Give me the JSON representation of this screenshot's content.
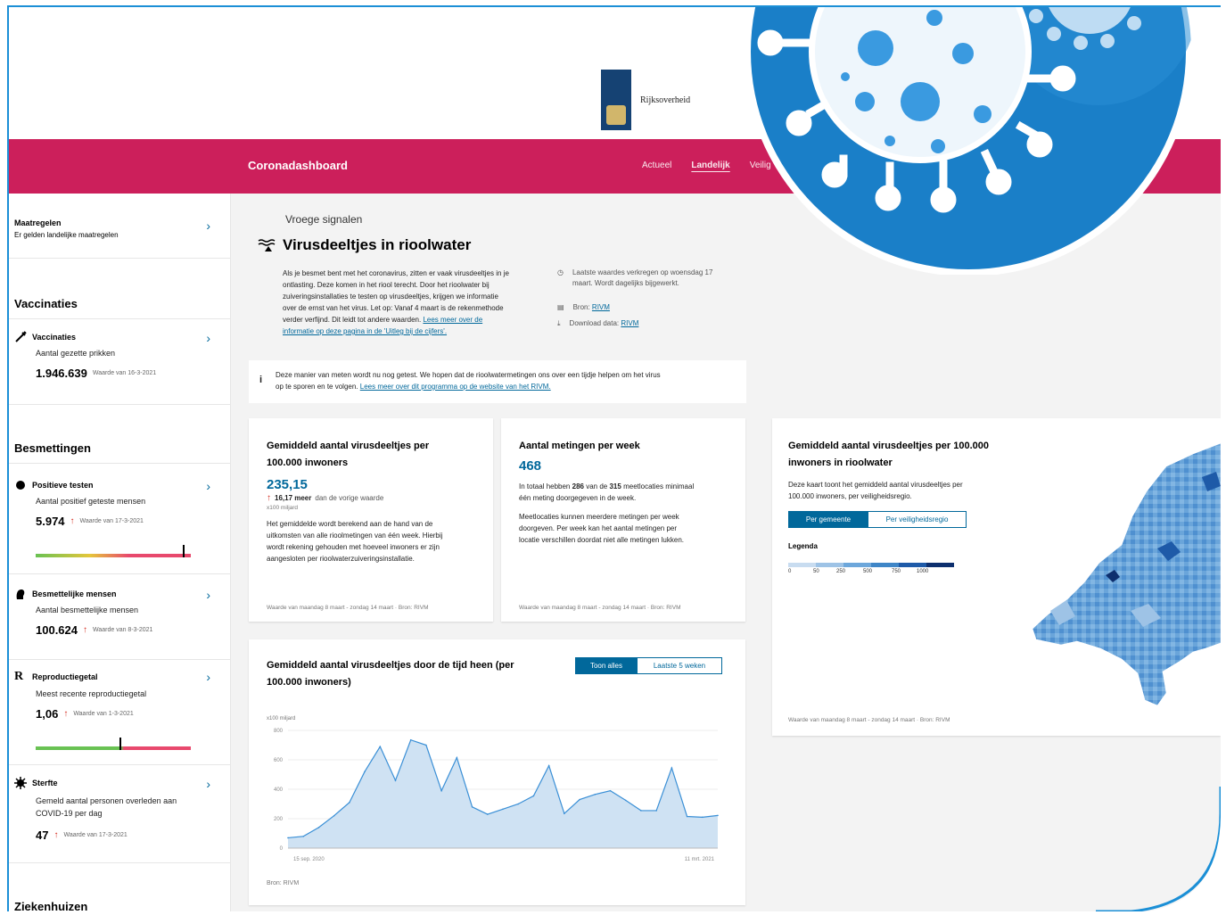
{
  "header": {
    "logo_text": "Rijksoverheid",
    "brand": "Coronadashboard",
    "nav": [
      "Actueel",
      "Landelijk",
      "Veilig"
    ]
  },
  "sidebar": {
    "maatregelen": {
      "title": "Maatregelen",
      "sub": "Er gelden landelijke maatregelen"
    },
    "vaccinaties_head": "Vaccinaties",
    "vaccinaties": {
      "title": "Vaccinaties",
      "sub": "Aantal gezette prikken",
      "value": "1.946.639",
      "date": "Waarde van 16-3-2021"
    },
    "besmettingen_head": "Besmettingen",
    "positieve": {
      "title": "Positieve testen",
      "sub": "Aantal positief geteste mensen",
      "value": "5.974",
      "date": "Waarde van 17-3-2021"
    },
    "besmettelijk": {
      "title": "Besmettelijke mensen",
      "sub": "Aantal besmettelijke mensen",
      "value": "100.624",
      "date": "Waarde van 8-3-2021"
    },
    "reproductie": {
      "title": "Reproductiegetal",
      "sub": "Meest recente reproductiegetal",
      "value": "1,06",
      "date": "Waarde van 1-3-2021",
      "letter": "R"
    },
    "sterfte": {
      "title": "Sterfte",
      "sub1": "Gemeld aantal personen overleden aan",
      "sub2": "COVID-19 per dag",
      "value": "47",
      "date": "Waarde van 17-3-2021"
    },
    "ziekenhuizen_head": "Ziekenhuizen"
  },
  "main": {
    "crumb": "Vroege signalen",
    "title": "Virusdeeltjes in rioolwater",
    "intro": [
      "Als je besmet bent met het coronavirus, zitten er vaak virusdeeltjes in je",
      "ontlasting. Deze komen in het riool terecht. Door het rioolwater bij",
      "zuiveringsinstallaties te testen op virusdeeltjes, krijgen we informatie",
      "over de ernst van het virus. Let op: Vanaf 4 maart is de rekenmethode",
      "verder verfijnd. Dit leidt tot andere waarden."
    ],
    "intro_link1": "Lees meer over de",
    "intro_link2": "informatie op deze pagina in de 'Uitleg bij de cijfers'.",
    "meta_time1": "Laatste waardes verkregen op woensdag 17",
    "meta_time2": "maart. Wordt dagelijks bijgewerkt.",
    "meta_source_label": "Bron:",
    "meta_source": "RIVM",
    "meta_download_label": "Download data:",
    "meta_download": "RIVM",
    "notice1": "Deze manier van meten wordt nu nog getest. We hopen dat de rioolwatermetingen ons over een tijdje helpen om het virus",
    "notice2_pre": "op te sporen en te volgen.",
    "notice2_link": "Lees meer over dit programma op de website van het RIVM."
  },
  "card_avg": {
    "title1": "Gemiddeld aantal virusdeeltjes per",
    "title2": "100.000 inwoners",
    "value": "235,15",
    "delta": "16,17 meer",
    "delta_rest": "dan de vorige waarde",
    "unit": "x100 miljard",
    "body": [
      "Het gemiddelde wordt berekend aan de hand van de",
      "uitkomsten van alle rioolmetingen van één week. Hierbij",
      "wordt rekening gehouden met hoeveel inwoners er zijn",
      "aangesloten per rioolwaterzuiveringsinstallatie."
    ],
    "foot": "Waarde van maandag 8 maart - zondag 14 maart · Bron: RIVM"
  },
  "card_count": {
    "title": "Aantal metingen per week",
    "value": "468",
    "line1_a": "In totaal hebben",
    "line1_b": "286",
    "line1_c": "van de",
    "line1_d": "315",
    "line1_e": "meetlocaties minimaal",
    "line2": "één meting doorgegeven in de week.",
    "body": [
      "Meetlocaties kunnen meerdere metingen per week",
      "doorgeven. Per week kan het aantal metingen per",
      "locatie verschillen doordat niet alle metingen lukken."
    ],
    "foot": "Waarde van maandag 8 maart - zondag 14 maart · Bron: RIVM"
  },
  "card_map": {
    "title1": "Gemiddeld aantal virusdeeltjes per 100.000",
    "title2": "inwoners in rioolwater",
    "desc1": "Deze kaart toont het gemiddeld aantal virusdeeltjes per",
    "desc2": "100.000 inwoners, per veiligheidsregio.",
    "btn_on": "Per gemeente",
    "btn_off": "Per veiligheidsregio",
    "legend_label": "Legenda",
    "legend_ticks": [
      "0",
      "50",
      "250",
      "500",
      "750",
      "1000"
    ],
    "legend_colors": [
      "#c8dcf0",
      "#9ec3e6",
      "#6da7db",
      "#3f86c7",
      "#1e5aa8",
      "#0d2f6e"
    ],
    "foot": "Waarde van maandag 8 maart - zondag 14 maart · Bron: RIVM"
  },
  "card_chart": {
    "title1": "Gemiddeld aantal virusdeeltjes door de tijd heen (per",
    "title2": "100.000 inwoners)",
    "btn_on": "Toon alles",
    "btn_off": "Laatste 5 weken",
    "unit": "x100 miljard",
    "source": "Bron: RIVM"
  },
  "chart_data": {
    "type": "area",
    "ylim": [
      0,
      800
    ],
    "yticks": [
      "0",
      "200",
      "400",
      "600",
      "800"
    ],
    "xticks": [
      "15 sep. 2020",
      "11 mrt. 2021"
    ],
    "values": [
      70,
      80,
      140,
      220,
      310,
      520,
      690,
      460,
      735,
      700,
      390,
      615,
      280,
      230,
      265,
      300,
      355,
      560,
      235,
      330,
      365,
      390,
      325,
      255,
      255,
      545,
      215,
      210,
      222
    ],
    "area_color": "#cfe2f3",
    "line_color": "#3a8fd6"
  },
  "colors": {
    "brand": "#cc1f5b",
    "accent": "#01689b",
    "frame": "#1b8fd6"
  }
}
